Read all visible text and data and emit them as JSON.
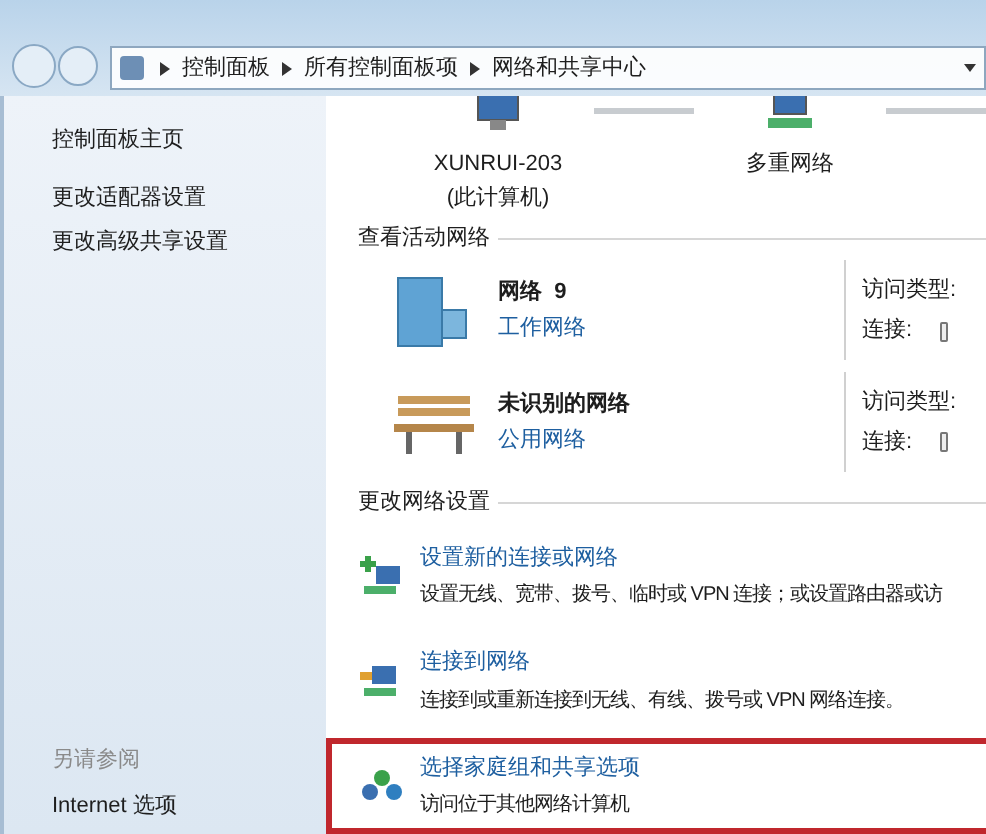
{
  "address_bar": {
    "breadcrumbs": [
      "控制面板",
      "所有控制面板项",
      "网络和共享中心"
    ]
  },
  "sidebar": {
    "items": [
      "控制面板主页",
      "更改适配器设置",
      "更改高级共享设置"
    ],
    "see_also_title": "另请参阅",
    "see_also_items": [
      "Internet 选项"
    ]
  },
  "network_map": [
    {
      "kind": "computer",
      "name": "XUNRUI-203",
      "sub": "(此计算机)"
    },
    {
      "kind": "network",
      "name": "多重网络"
    }
  ],
  "active_networks": {
    "title": "查看活动网络",
    "items": [
      {
        "kind": "building",
        "name": "网络  9",
        "type": "工作网络",
        "access_label": "访问类型:",
        "connection_label": "连接:"
      },
      {
        "kind": "bench",
        "name": "未识别的网络",
        "type": "公用网络",
        "access_label": "访问类型:",
        "connection_label": "连接:"
      }
    ]
  },
  "change_settings": {
    "title": "更改网络设置",
    "items": [
      {
        "kind": "new",
        "title": "设置新的连接或网络",
        "description": "设置无线、宽带、拨号、临时或 VPN 连接；或设置路由器或访",
        "highlighted": false
      },
      {
        "kind": "connect",
        "title": "连接到网络",
        "description": "连接到或重新连接到无线、有线、拨号或 VPN 网络连接。",
        "highlighted": false
      },
      {
        "kind": "homegroup",
        "title": "选择家庭组和共享选项",
        "description": "访问位于其他网络计算机",
        "highlighted": true
      }
    ]
  }
}
